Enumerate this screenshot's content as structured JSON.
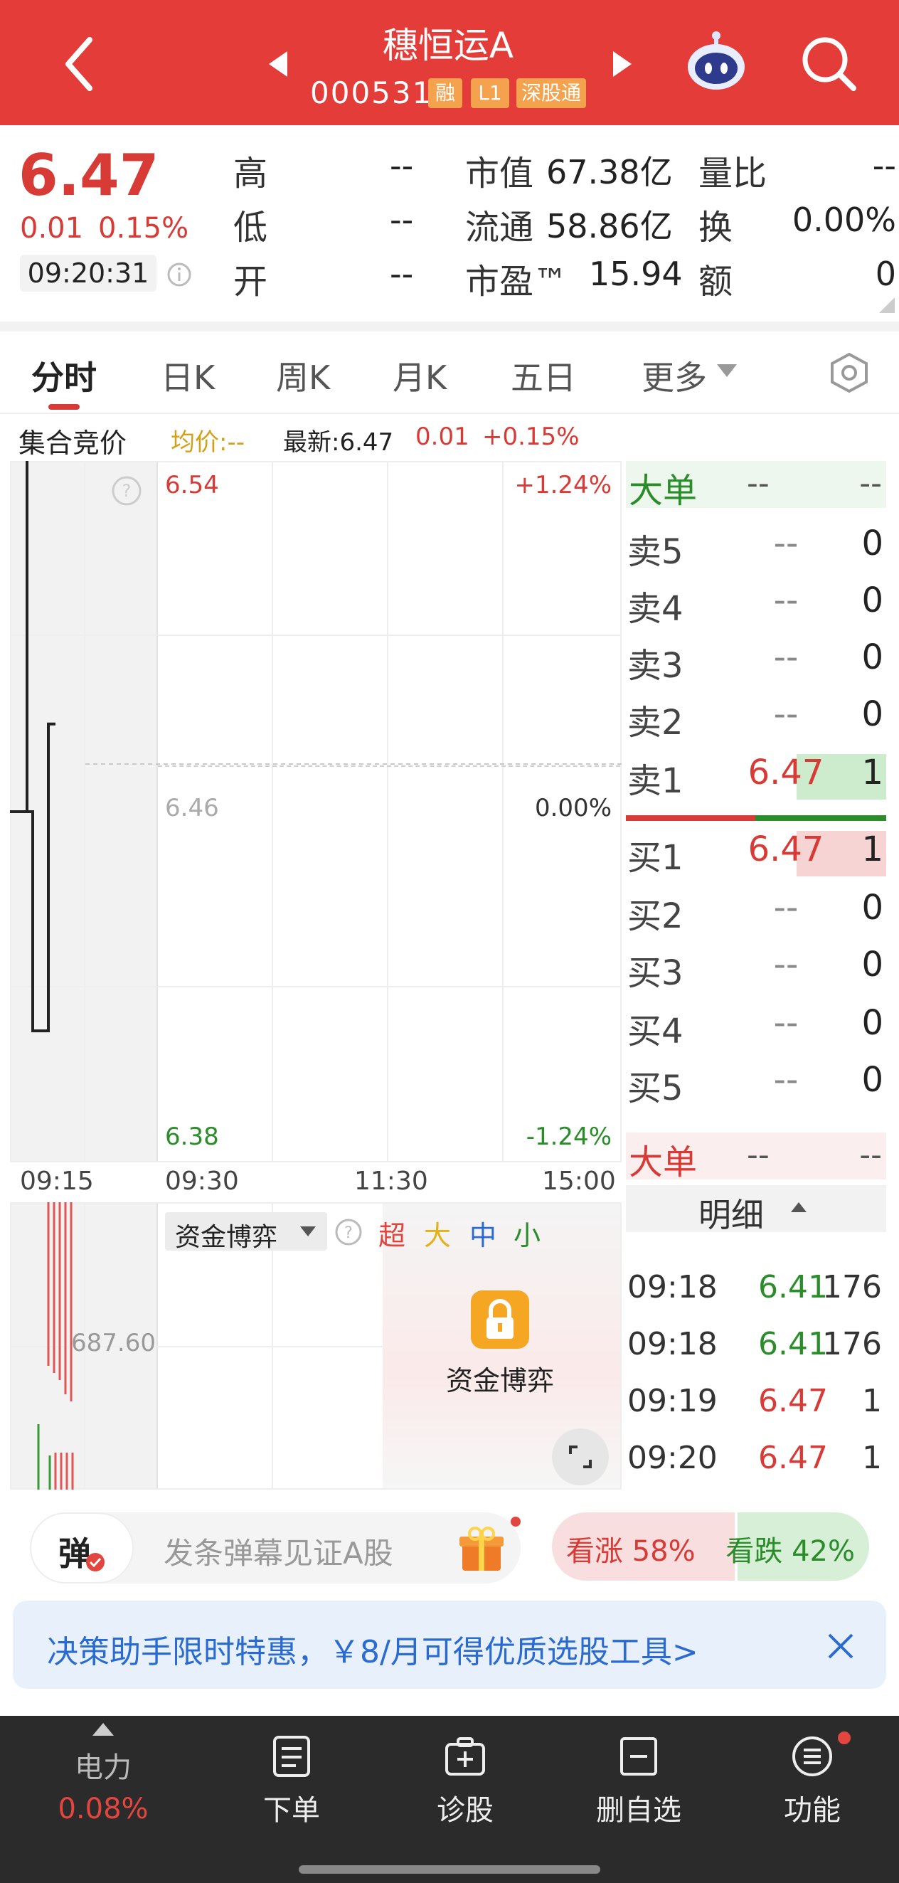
{
  "header": {
    "title": "穗恒运A",
    "code": "000531",
    "tags": [
      "融",
      "L1",
      "深股通"
    ]
  },
  "quote": {
    "price": "6.47",
    "change": "0.01",
    "change_pct": "0.15%",
    "time": "09:20:31",
    "high_label": "高",
    "high_value": "--",
    "low_label": "低",
    "low_value": "--",
    "open_label": "开",
    "open_value": "--",
    "mktcap_label": "市值",
    "mktcap_value": "67.38亿",
    "float_label": "流通",
    "float_value": "58.86亿",
    "pe_label": "市盈™",
    "pe_value": "15.94",
    "vr_label": "量比",
    "vr_value": "--",
    "turnover_label": "换",
    "turnover_value": "0.00%",
    "amount_label": "额",
    "amount_value": "0"
  },
  "tabs": [
    "分时",
    "日K",
    "周K",
    "月K",
    "五日",
    "更多"
  ],
  "chart_info": {
    "mode": "集合竞价",
    "avg": "均价:--",
    "latest": "最新:6.47",
    "chg": "0.01",
    "chg_pct": "+0.15%",
    "y_top": "6.54",
    "y_mid": "6.46",
    "y_bot": "6.38",
    "pct_top": "+1.24%",
    "pct_mid": "0.00%",
    "pct_bot": "-1.24%",
    "x_labels": [
      "09:15",
      "09:30",
      "11:30",
      "15:00"
    ],
    "vol_label": "687.60"
  },
  "chart_data": {
    "type": "line",
    "x": [
      "09:15",
      "09:16",
      "09:17",
      "09:18",
      "09:19",
      "09:20"
    ],
    "y": [
      6.54,
      6.46,
      6.41,
      6.41,
      6.48,
      6.48
    ],
    "ylim": [
      6.38,
      6.54
    ]
  },
  "capital": {
    "selector": "资金博弈",
    "cats": [
      "超",
      "大",
      "中",
      "小"
    ],
    "lock_label": "资金博弈"
  },
  "orderbook": {
    "big_label": "大单",
    "big_v1": "--",
    "big_v2": "--",
    "asks": [
      {
        "label": "卖5",
        "price": "--",
        "vol": "0"
      },
      {
        "label": "卖4",
        "price": "--",
        "vol": "0"
      },
      {
        "label": "卖3",
        "price": "--",
        "vol": "0"
      },
      {
        "label": "卖2",
        "price": "--",
        "vol": "0"
      },
      {
        "label": "卖1",
        "price": "6.47",
        "vol": "1"
      }
    ],
    "bids": [
      {
        "label": "买1",
        "price": "6.47",
        "vol": "1"
      },
      {
        "label": "买2",
        "price": "--",
        "vol": "0"
      },
      {
        "label": "买3",
        "price": "--",
        "vol": "0"
      },
      {
        "label": "买4",
        "price": "--",
        "vol": "0"
      },
      {
        "label": "买5",
        "price": "--",
        "vol": "0"
      }
    ],
    "big2_label": "大单",
    "big2_v1": "--",
    "big2_v2": "--",
    "detail_label": "明细"
  },
  "ticks": [
    {
      "time": "09:18",
      "price": "6.41",
      "vol": "176"
    },
    {
      "time": "09:18",
      "price": "6.41",
      "vol": "176"
    },
    {
      "time": "09:19",
      "price": "6.47",
      "vol": "1"
    },
    {
      "time": "09:20",
      "price": "6.47",
      "vol": "1"
    }
  ],
  "danmu": {
    "icon": "弹",
    "placeholder": "发条弹幕见证A股",
    "up": "看涨 58%",
    "down": "看跌 42%",
    "up_ratio": 0.58
  },
  "banner": {
    "text": "决策助手限时特惠，￥8/月可得优质选股工具>"
  },
  "bottom_nav": {
    "power_label": "电力",
    "power_value": "0.08%",
    "items": [
      "下单",
      "诊股",
      "删自选",
      "功能"
    ]
  },
  "colors": {
    "up": "#d83a35",
    "down": "#2a8d2a",
    "header": "#e33c39",
    "nav": "#2b2b2b"
  }
}
